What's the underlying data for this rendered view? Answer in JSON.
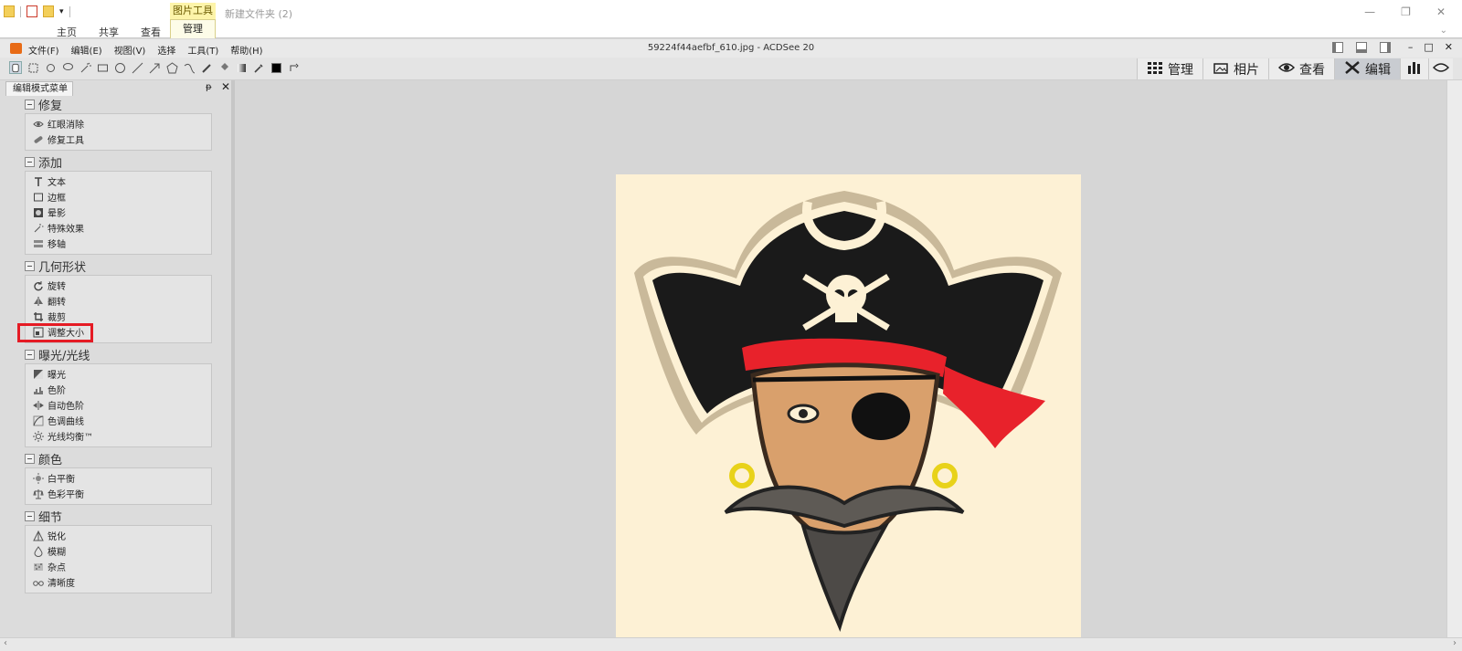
{
  "explorer": {
    "context_tab": "图片工具",
    "context_sub": "管理",
    "folder_title": "新建文件夹 (2)",
    "tabs": [
      "主页",
      "共享",
      "查看"
    ]
  },
  "app": {
    "menus": [
      "文件(F)",
      "编辑(E)",
      "视图(V)",
      "选择",
      "工具(T)",
      "帮助(H)"
    ],
    "title": "59224f44aefbf_610.jpg - ACDSee 20",
    "modes": [
      {
        "label": "管理",
        "icon": "grid-icon"
      },
      {
        "label": "相片",
        "icon": "photos-icon"
      },
      {
        "label": "查看",
        "icon": "eye-icon"
      },
      {
        "label": "编辑",
        "icon": "edit-tools-icon"
      }
    ]
  },
  "panel": {
    "tab_label": "编辑模式菜单",
    "sections": [
      {
        "title": "修复",
        "items": [
          {
            "label": "红眼消除",
            "icon": "eye-icon"
          },
          {
            "label": "修复工具",
            "icon": "bandage-icon"
          }
        ]
      },
      {
        "title": "添加",
        "items": [
          {
            "label": "文本",
            "icon": "text-icon"
          },
          {
            "label": "边框",
            "icon": "border-icon"
          },
          {
            "label": "晕影",
            "icon": "vignette-icon"
          },
          {
            "label": "特殊效果",
            "icon": "magic-wand-icon"
          },
          {
            "label": "移轴",
            "icon": "tilt-shift-icon"
          }
        ]
      },
      {
        "title": "几何形状",
        "items": [
          {
            "label": "旋转",
            "icon": "rotate-icon"
          },
          {
            "label": "翻转",
            "icon": "flip-icon"
          },
          {
            "label": "裁剪",
            "icon": "crop-icon"
          },
          {
            "label": "调整大小",
            "icon": "resize-icon",
            "highlighted": true
          }
        ]
      },
      {
        "title": "曝光/光线",
        "items": [
          {
            "label": "曝光",
            "icon": "exposure-icon"
          },
          {
            "label": "色阶",
            "icon": "levels-icon"
          },
          {
            "label": "自动色阶",
            "icon": "auto-levels-icon"
          },
          {
            "label": "色调曲线",
            "icon": "curves-icon"
          },
          {
            "label": "光线均衡™",
            "icon": "sun-icon"
          }
        ]
      },
      {
        "title": "颜色",
        "items": [
          {
            "label": "白平衡",
            "icon": "white-balance-icon"
          },
          {
            "label": "色彩平衡",
            "icon": "scale-icon"
          }
        ]
      },
      {
        "title": "细节",
        "items": [
          {
            "label": "锐化",
            "icon": "sharpen-icon"
          },
          {
            "label": "模糊",
            "icon": "blur-drop-icon"
          },
          {
            "label": "杂点",
            "icon": "noise-icon"
          },
          {
            "label": "清晰度",
            "icon": "glasses-icon"
          }
        ]
      }
    ]
  },
  "colors": {
    "highlight": "#e51b24",
    "image_background": "#fdf1d5",
    "bandana": "#e8222b"
  }
}
